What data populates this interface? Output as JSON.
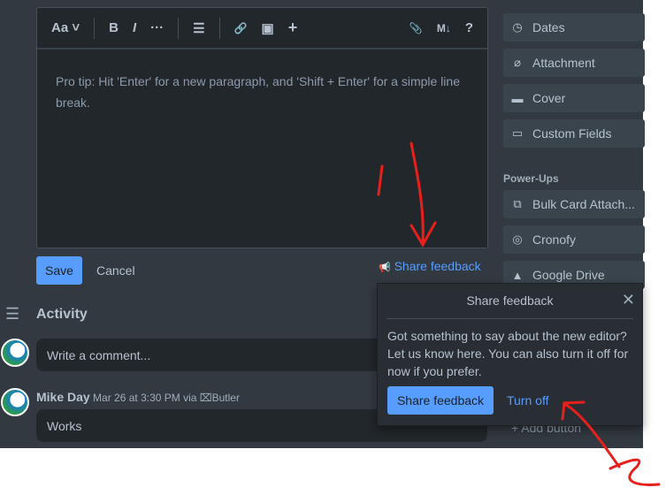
{
  "toolbar": {
    "text_style": "Aa",
    "bold": "B",
    "italic": "I",
    "more": "···",
    "list": "☰",
    "link": "🔗",
    "image": "▣",
    "insert": "+",
    "attach": "📎",
    "markdown": "M↓",
    "help": "?"
  },
  "editor": {
    "placeholder": "Pro tip: Hit 'Enter' for a new paragraph, and 'Shift + Enter' for a simple line break."
  },
  "actions": {
    "save": "Save",
    "cancel": "Cancel",
    "share_feedback": "Share feedback"
  },
  "activity": {
    "title": "Activity",
    "comment_placeholder": "Write a comment...",
    "entries": [
      {
        "author": "Mike Day",
        "meta": "Mar 26 at 3:30 PM via",
        "via": "Butler",
        "text": "Works"
      }
    ]
  },
  "sidebar": {
    "items": [
      {
        "label": "Dates",
        "icon": "clock-icon"
      },
      {
        "label": "Attachment",
        "icon": "paperclip-icon"
      },
      {
        "label": "Cover",
        "icon": "cover-icon"
      },
      {
        "label": "Custom Fields",
        "icon": "fields-icon"
      }
    ],
    "powerups_title": "Power-Ups",
    "powerups": [
      {
        "label": "Bulk Card Attach...",
        "icon": "bulk-icon"
      },
      {
        "label": "Cronofy",
        "icon": "cronofy-icon"
      },
      {
        "label": "Google Drive",
        "icon": "drive-icon"
      }
    ],
    "add_button": "Add button"
  },
  "popup": {
    "title": "Share feedback",
    "body": "Got something to say about the new editor? Let us know here. You can also turn it off for now if you prefer.",
    "share": "Share feedback",
    "turn_off": "Turn off"
  },
  "annotations": {
    "color": "#e8201c"
  }
}
